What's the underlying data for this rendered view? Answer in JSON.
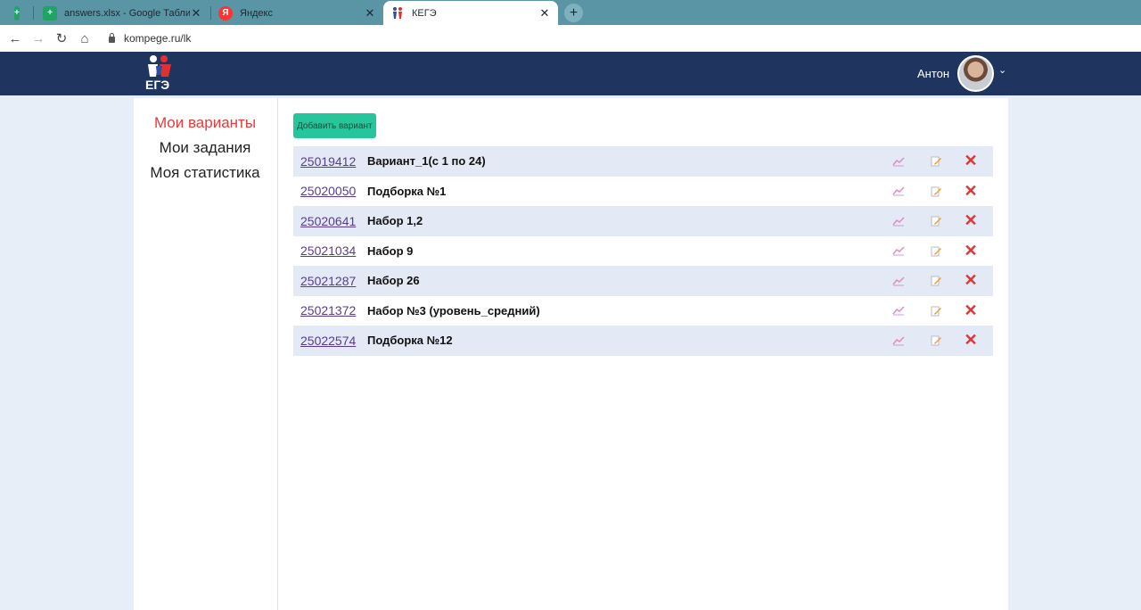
{
  "browser": {
    "tabs": [
      {
        "title": "",
        "favicon": "green-sheet-icon",
        "active": false
      },
      {
        "title": "answers.xlsx - Google Таблицы",
        "favicon": "green-sheet-icon",
        "active": false
      },
      {
        "title": "Яндекс",
        "favicon": "yandex-icon",
        "active": false
      },
      {
        "title": "КЕГЭ",
        "favicon": "kege-icon",
        "active": true
      }
    ],
    "new_tab": "+",
    "url": "kompege.ru/lk"
  },
  "header": {
    "logo_text": "ЕГЭ",
    "user_name": "Антон"
  },
  "sidebar": {
    "items": [
      {
        "label": "Мои варианты",
        "active": true
      },
      {
        "label": "Мои задания",
        "active": false
      },
      {
        "label": "Моя статистика",
        "active": false
      }
    ]
  },
  "main": {
    "add_button": "Добавить вариант",
    "variants": [
      {
        "id": "25019412",
        "name": "Вариант_1(с 1 по 24)"
      },
      {
        "id": "25020050",
        "name": "Подборка №1"
      },
      {
        "id": "25020641",
        "name": "Набор 1,2"
      },
      {
        "id": "25021034",
        "name": "Набор 9"
      },
      {
        "id": "25021287",
        "name": "Набор 26"
      },
      {
        "id": "25021372",
        "name": "Набор №3 (уровень_средний)"
      },
      {
        "id": "25022574",
        "name": "Подборка №12"
      }
    ]
  },
  "colors": {
    "header_bg": "#1f3560",
    "accent_red": "#e63a3a",
    "add_button_bg": "#26c59b",
    "row_stripe": "#e3e9f5"
  }
}
